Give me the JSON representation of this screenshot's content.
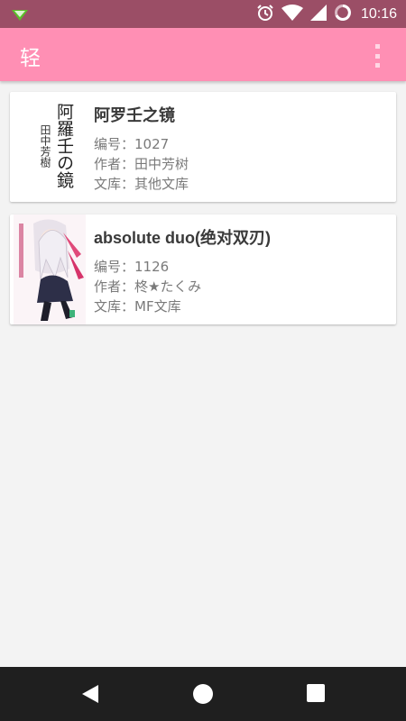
{
  "status_bar": {
    "time": "10:16"
  },
  "app_bar": {
    "title": "轻"
  },
  "books": [
    {
      "title": "阿罗壬之镜",
      "number_label": "编号：",
      "number": "1027",
      "author_label": "作者：",
      "author": "田中芳树",
      "library_label": "文库：",
      "library": "其他文库",
      "cover_text_main": "阿羅壬の鏡",
      "cover_text_author": "田中芳樹"
    },
    {
      "title": "absolute duo(绝对双刃)",
      "number_label": "编号：",
      "number": "1126",
      "author_label": "作者：",
      "author": "柊★たくみ",
      "library_label": "文库：",
      "library": "MF文库"
    }
  ],
  "colors": {
    "status_bar": "#9b4e66",
    "app_bar": "#ff8fb4",
    "background": "#f3f3f3",
    "nav_bar": "#1f1f1f"
  }
}
